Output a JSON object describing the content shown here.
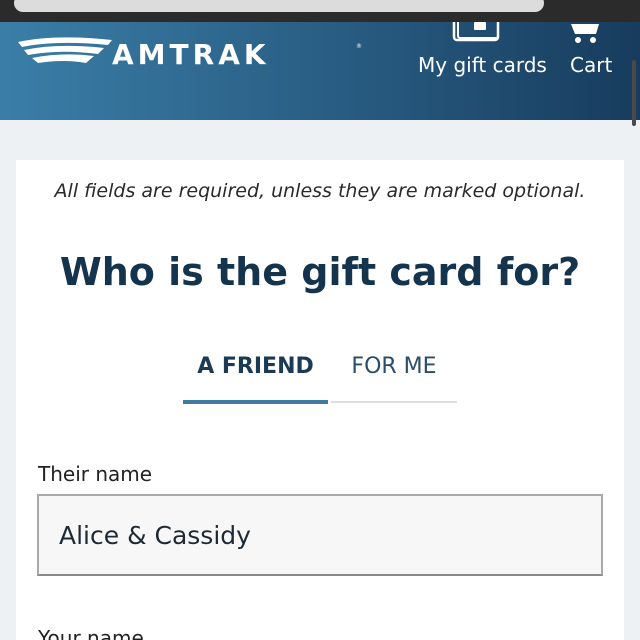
{
  "header": {
    "brand": "AMTRAK",
    "nav": {
      "gift_cards_label": "My gift cards",
      "cart_label": "Cart"
    }
  },
  "form": {
    "required_note": "All fields are required, unless they are marked optional.",
    "question": "Who is the gift card for?",
    "tabs": [
      {
        "label": "A FRIEND",
        "active": true
      },
      {
        "label": "FOR ME",
        "active": false
      }
    ],
    "their_name": {
      "label": "Their name",
      "value": "Alice & Cassidy"
    },
    "your_name": {
      "label": "Your name"
    }
  },
  "colors": {
    "header_start": "#3a7ea7",
    "header_end": "#173c5d",
    "heading_text": "#14334d",
    "tab_accent": "#3f7aa3"
  },
  "icons": {
    "gift": "gift-cards-icon",
    "cart": "cart-icon",
    "logo": "amtrak-logo-icon"
  }
}
